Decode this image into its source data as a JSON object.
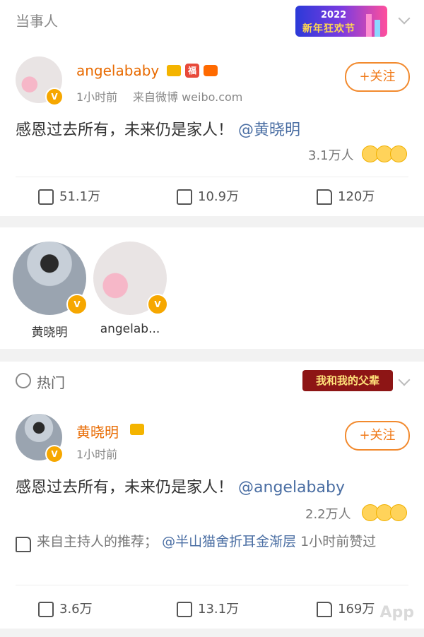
{
  "header": {
    "title": "当事人",
    "banner_text_year": "2022",
    "banner_text_sub": "新年狂欢节"
  },
  "post1": {
    "username": "angelababy",
    "badge_fu": "福",
    "time": "1小时前",
    "source": "来自微博 weibo.com",
    "follow_label": "+关注",
    "text_main": "感恩过去所有，未来仍是家人！",
    "mention": "@黄晓明",
    "likes_summary": "3.1万人",
    "repost": "51.1万",
    "comment": "10.9万",
    "like": "120万"
  },
  "related": {
    "people": [
      {
        "name": "黄晓明"
      },
      {
        "name": "angelab..."
      }
    ]
  },
  "hot": {
    "label": "热门",
    "banner_text": "我和我的父辈"
  },
  "post2": {
    "username": "黄晓明",
    "time": "1小时前",
    "follow_label": "+关注",
    "text_main": "感恩过去所有，未来仍是家人！",
    "mention": "@angelababy",
    "likes_summary": "2.2万人",
    "rec_prefix": "来自主持人的推荐；",
    "rec_mention": "@半山猫舍折耳金渐层",
    "rec_suffix": "1小时前赞过",
    "repost": "3.6万",
    "comment": "13.1万",
    "like": "169万"
  },
  "watermark": "App",
  "colors": {
    "orange": "#e86a00",
    "mention_blue": "#4a6ea3",
    "follow_border": "#f28a2e"
  }
}
